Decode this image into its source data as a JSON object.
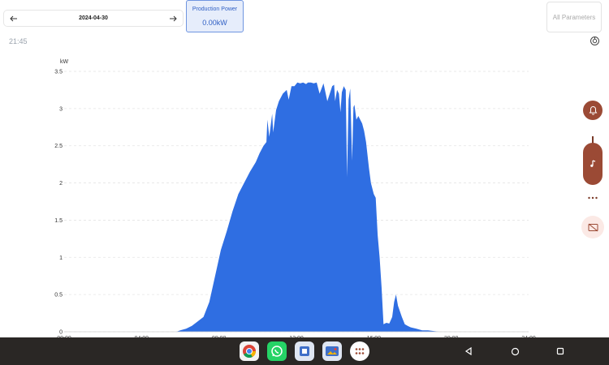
{
  "header": {
    "date": "2024-04-30",
    "power_card": {
      "label": "Production Power",
      "value": "0.00kW"
    },
    "all_parameters_label": "All Parameters",
    "time": "21:45"
  },
  "icons": {
    "prev": "arrow-left-icon",
    "next": "arrow-right-icon",
    "refresh": "refresh-icon",
    "bell": "bell-icon",
    "music": "music-note-icon",
    "more": "more-dots-icon",
    "screen_off": "screen-off-icon"
  },
  "colors": {
    "fill": "#2f6ee2",
    "accent": "#2f5fc4",
    "floating": "#9b4a35",
    "taskbar": "#2a2725"
  },
  "taskbar": {
    "apps": [
      "chrome-icon",
      "whatsapp-icon",
      "files-icon",
      "gallery-icon",
      "app-drawer-icon"
    ],
    "nav": [
      "back-icon",
      "home-icon",
      "recents-icon"
    ]
  },
  "chart_data": {
    "type": "area",
    "ylabel": "kW",
    "ylim": [
      0,
      3.5
    ],
    "yticks": [
      "0",
      "0.5",
      "1",
      "1.5",
      "2",
      "2.5",
      "3",
      "3.5"
    ],
    "xticks": [
      "00:00",
      "04:00",
      "08:00",
      "12:00",
      "16:00",
      "20:00",
      "24:00"
    ],
    "xlim": [
      0,
      24
    ],
    "grid": true,
    "x": [
      0,
      5.8,
      6.0,
      6.3,
      6.6,
      6.9,
      7.2,
      7.5,
      7.8,
      8.1,
      8.4,
      8.7,
      9.0,
      9.3,
      9.6,
      9.9,
      10.1,
      10.3,
      10.45,
      10.5,
      10.6,
      10.75,
      10.8,
      10.95,
      11.1,
      11.3,
      11.5,
      11.6,
      11.75,
      11.9,
      12.05,
      12.2,
      12.35,
      12.5,
      12.6,
      12.75,
      12.9,
      13.05,
      13.2,
      13.4,
      13.6,
      13.85,
      13.95,
      14.0,
      14.1,
      14.2,
      14.28,
      14.35,
      14.45,
      14.55,
      14.62,
      14.7,
      14.78,
      14.88,
      14.95,
      15.0,
      15.1,
      15.2,
      15.28,
      15.4,
      15.5,
      15.6,
      15.75,
      15.85,
      16.0,
      16.1,
      16.2,
      16.3,
      16.4,
      16.5,
      16.65,
      16.8,
      16.95,
      17.05,
      17.15,
      17.25,
      17.45,
      17.6,
      17.75,
      17.9,
      18.05,
      18.2,
      18.5,
      18.8,
      19.1,
      19.4,
      19.7,
      20.0,
      20.3,
      24.0
    ],
    "y": [
      0,
      0,
      0.02,
      0.04,
      0.08,
      0.14,
      0.2,
      0.4,
      0.75,
      1.1,
      1.35,
      1.62,
      1.85,
      2.0,
      2.15,
      2.28,
      2.4,
      2.5,
      2.55,
      2.85,
      2.62,
      2.93,
      2.68,
      2.98,
      3.1,
      3.2,
      3.25,
      3.12,
      3.3,
      3.3,
      3.35,
      3.34,
      3.35,
      3.33,
      3.35,
      3.35,
      3.34,
      3.35,
      3.2,
      3.34,
      3.1,
      3.3,
      3.32,
      3.1,
      3.25,
      3.2,
      2.95,
      3.22,
      3.3,
      3.25,
      2.08,
      3.12,
      3.27,
      2.3,
      3.02,
      3.05,
      2.85,
      2.9,
      2.86,
      2.8,
      2.7,
      2.55,
      2.2,
      2.0,
      1.85,
      1.8,
      1.3,
      1.0,
      0.6,
      0.1,
      0.12,
      0.11,
      0.2,
      0.4,
      0.5,
      0.35,
      0.2,
      0.1,
      0.08,
      0.06,
      0.05,
      0.04,
      0.02,
      0.02,
      0.01,
      0,
      0,
      0,
      0,
      0
    ]
  }
}
